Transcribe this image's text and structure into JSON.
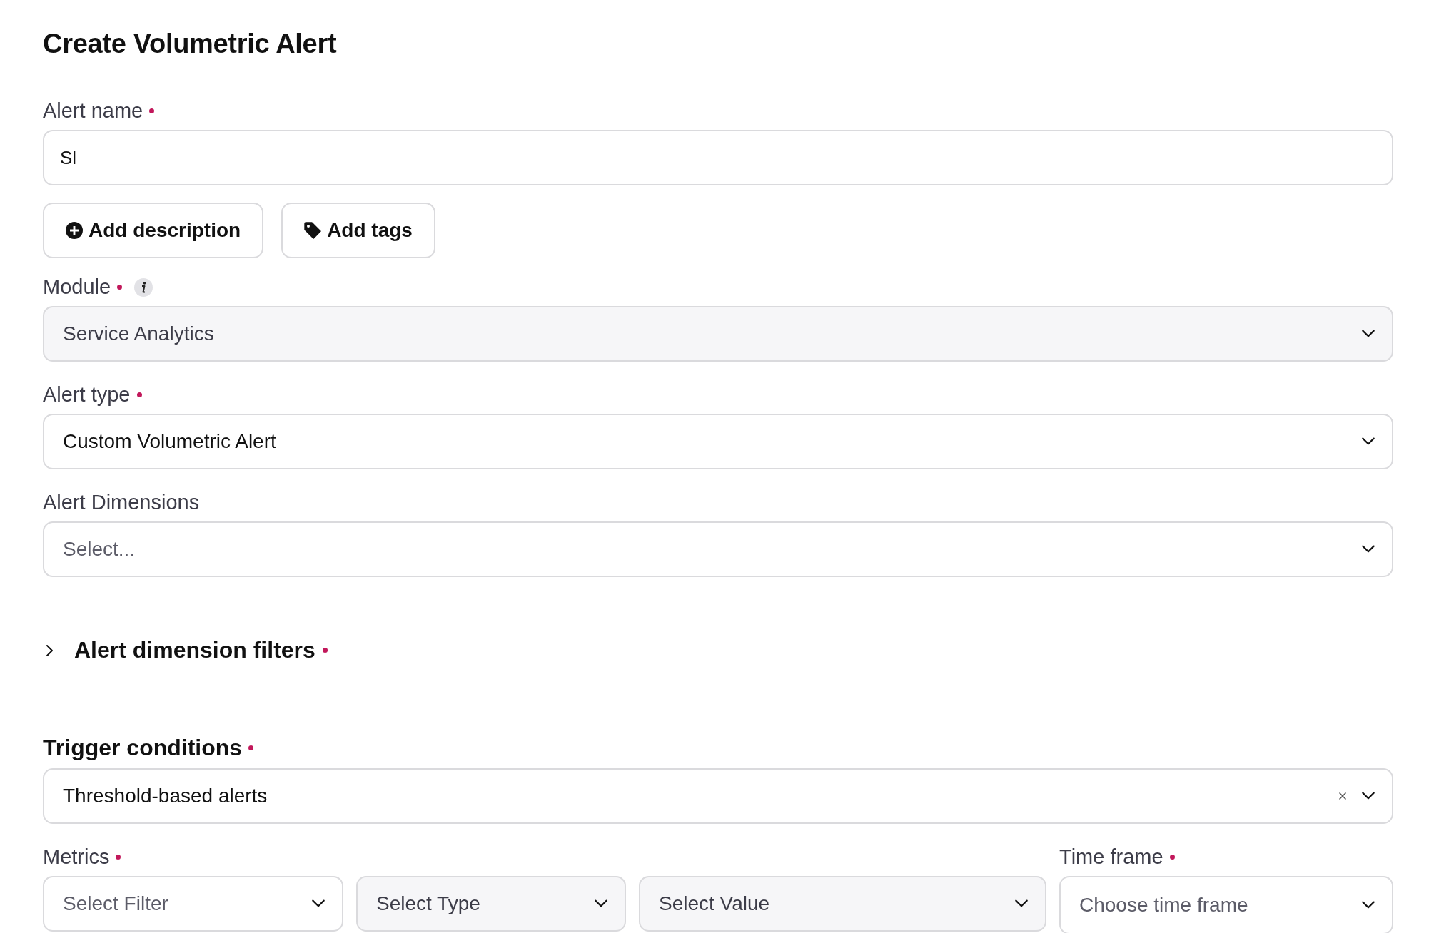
{
  "title": "Create Volumetric Alert",
  "alert_name": {
    "label": "Alert name",
    "required": true,
    "value": "Sl"
  },
  "actions": [
    {
      "kind": "description",
      "label": "Add description"
    },
    {
      "kind": "tags",
      "label": "Add tags"
    }
  ],
  "fields": [
    {
      "label": "Module",
      "required": true,
      "info": true,
      "value": "Service Analytics",
      "disabled": true
    },
    {
      "label": "Alert type",
      "required": true,
      "info": false,
      "value": "Custom Volumetric Alert",
      "disabled": false
    },
    {
      "label": "Alert Dimensions",
      "required": false,
      "info": false,
      "placeholder": "Select...",
      "disabled": false
    }
  ],
  "dimension_filters": {
    "label": "Alert dimension filters",
    "required": true,
    "expanded": false
  },
  "trigger": {
    "label": "Trigger conditions",
    "required": true,
    "value": "Threshold-based alerts",
    "clearable": true
  },
  "metrics": {
    "label": "Metrics",
    "required": true,
    "selects": [
      {
        "placeholder": "Select Filter",
        "disabled": false
      },
      {
        "placeholder": "Select Type",
        "disabled": true
      },
      {
        "placeholder": "Select Value",
        "disabled": true
      }
    ]
  },
  "time_frame": {
    "label": "Time frame",
    "required": true,
    "placeholder": "Choose time frame",
    "disabled": false
  }
}
